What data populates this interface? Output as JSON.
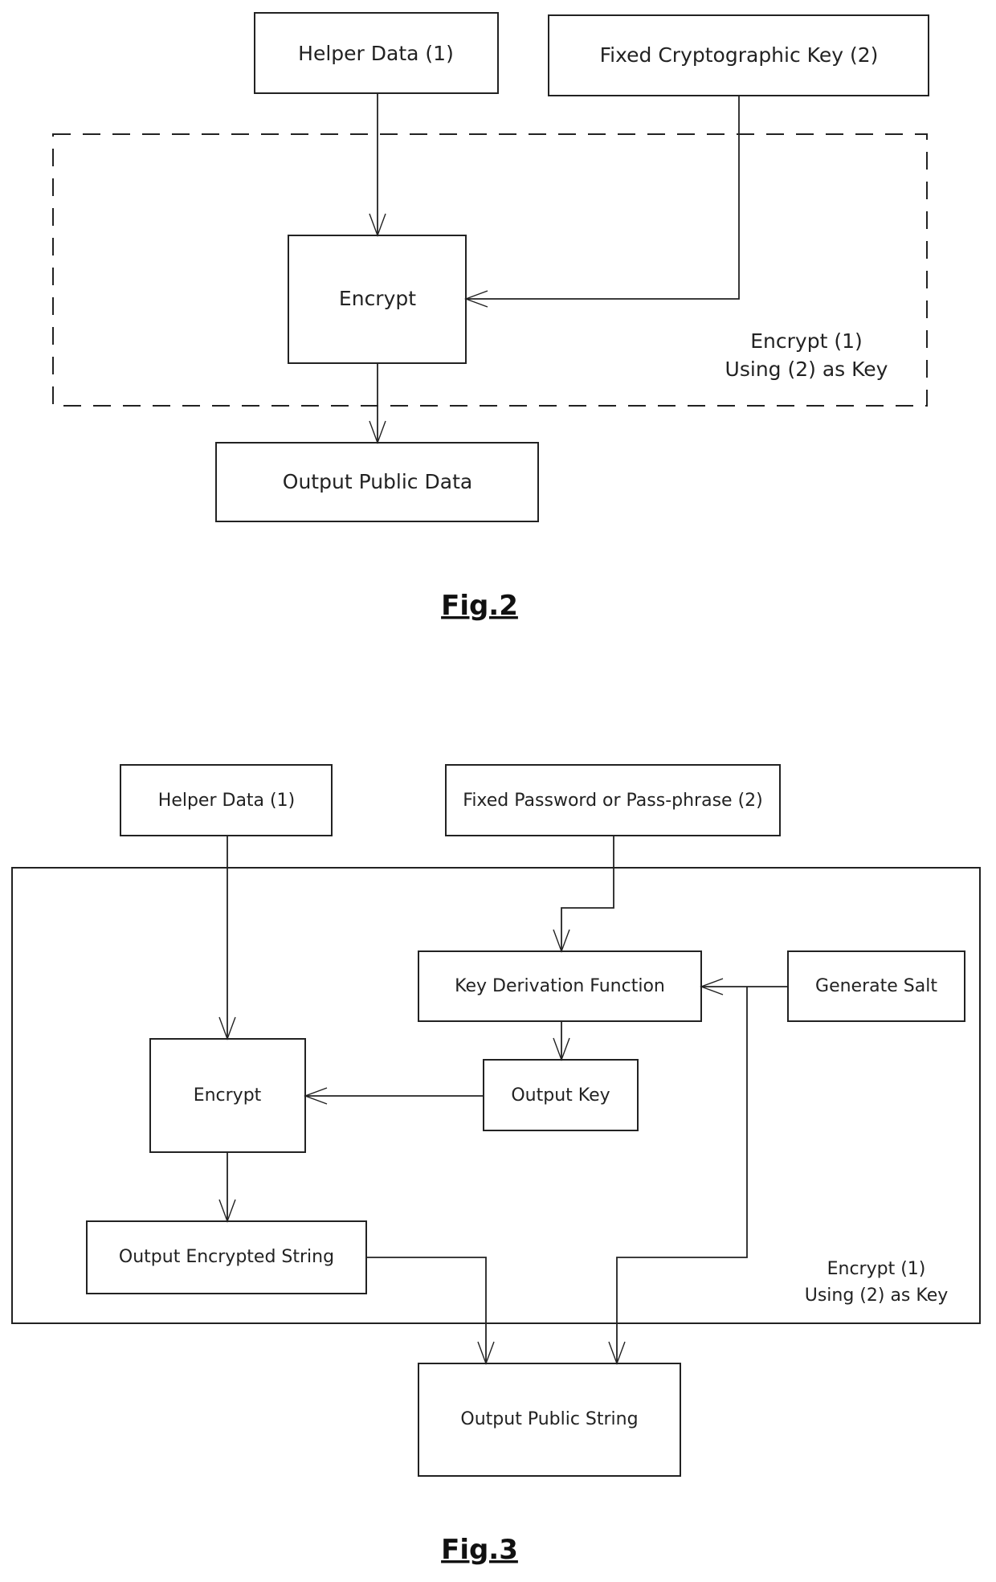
{
  "fig2": {
    "caption": "Fig.2",
    "helper_data": "Helper Data (1)",
    "fixed_key": "Fixed Cryptographic Key (2)",
    "encrypt": "Encrypt",
    "output": "Output Public Data",
    "group_label_line1": "Encrypt (1)",
    "group_label_line2": "Using (2) as Key"
  },
  "fig3": {
    "caption": "Fig.3",
    "helper_data": "Helper Data (1)",
    "password": "Fixed Password or Pass-phrase (2)",
    "kdf": "Key Derivation Function",
    "salt": "Generate Salt",
    "encrypt": "Encrypt",
    "output_key": "Output Key",
    "output_encrypted": "Output Encrypted String",
    "output_public": "Output Public String",
    "group_label_line1": "Encrypt (1)",
    "group_label_line2": "Using (2) as Key"
  }
}
